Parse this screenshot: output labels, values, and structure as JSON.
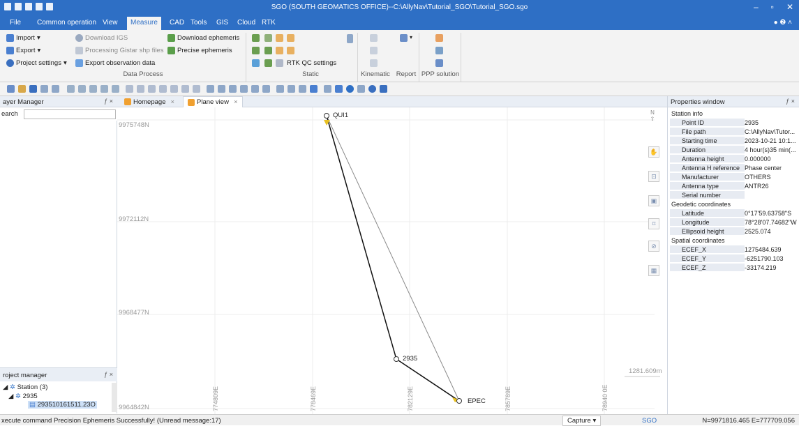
{
  "app_title": "SGO (SOUTH GEOMATICS OFFICE)--C:\\AllyNav\\Tutorial_SGO\\Tutorial_SGO.sgo",
  "menu": [
    "File",
    "Common operation",
    "View",
    "Measure",
    "CAD",
    "Tools",
    "GIS",
    "Cloud",
    "RTK"
  ],
  "ribbon": {
    "import": "Import",
    "export": "Export",
    "project_settings": "Project settings",
    "download_igs": "Download IGS",
    "processing_gistar": "Processing Gistar shp files",
    "export_obs": "Export observation data",
    "download_ephemeris": "Download ephemeris",
    "precise_ephemeris": "Precise ephemeris",
    "rtk_qc": "RTK QC settings",
    "groups": {
      "data_process": "Data Process",
      "static": "Static",
      "kinematic": "Kinematic",
      "report": "Report",
      "ppp": "PPP solution"
    }
  },
  "layer_manager": {
    "title": "ayer Manager",
    "search_label": "earch",
    "search_value": ""
  },
  "project_manager": {
    "title": "roject manager",
    "station": "Station (3)",
    "s2935": "2935",
    "file": "293510161511.23O"
  },
  "tabs": [
    "Homepage",
    "Plane view"
  ],
  "plane": {
    "n_labels": [
      "9975748N",
      "9972112N",
      "9968477N",
      "9964842N"
    ],
    "e_labels": [
      "774809E",
      "778469E",
      "782129E",
      "785789E",
      "78940 0E"
    ],
    "stations": {
      "qui1": "QUI1",
      "s2935": "2935",
      "epec": "EPEC"
    },
    "scale": "1281.609m",
    "north": "N"
  },
  "properties": {
    "title": "Properties window",
    "sections": {
      "station_info": "Station info",
      "geodetic": "Geodetic coordinates",
      "spatial": "Spatial coordinates"
    },
    "rows": [
      {
        "k": "Point ID",
        "v": "2935"
      },
      {
        "k": "File path",
        "v": "C:\\AllyNav\\Tutor..."
      },
      {
        "k": "Starting time",
        "v": "2023-10-21 10:1..."
      },
      {
        "k": "Duration",
        "v": "4 hour(s)35 min(..."
      },
      {
        "k": "Antenna height",
        "v": "0.000000"
      },
      {
        "k": "Antenna H reference",
        "v": "Phase center"
      },
      {
        "k": "Manufacturer",
        "v": "OTHERS"
      },
      {
        "k": "Antenna type",
        "v": "ANTR26"
      },
      {
        "k": "Serial number",
        "v": ""
      },
      {
        "k": "Latitude",
        "v": "0°17'59.63758\"S"
      },
      {
        "k": "Longitude",
        "v": "78°28'07.74682\"W"
      },
      {
        "k": "Ellipsoid height",
        "v": "2525.074"
      },
      {
        "k": "ECEF_X",
        "v": "1275484.639"
      },
      {
        "k": "ECEF_Y",
        "v": "-6251790.103"
      },
      {
        "k": "ECEF_Z",
        "v": "-33174.219"
      }
    ]
  },
  "status": {
    "message": "xecute command Precision Ephemeris Successfully! (Unread message:17)",
    "capture": "Capture",
    "sgo": "SGO",
    "coords": "N=9971816.465  E=777709.056"
  },
  "colors": {
    "title_bar": "#2e6fc5",
    "accent_orange": "#f0a030",
    "sgo_blue": "#2e6fc5"
  }
}
